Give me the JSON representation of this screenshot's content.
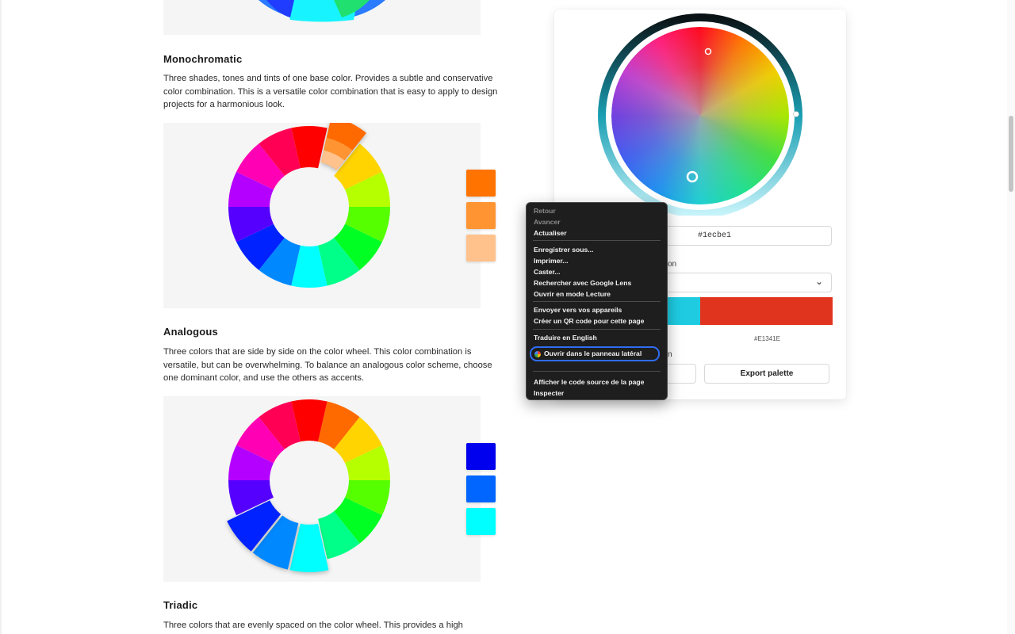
{
  "sections": [
    {
      "title": "Monochromatic",
      "description": "Three shades, tones and tints of one base color. Provides a subtle and conservative color combination. This is a versatile color combination that is easy to apply to design projects for a harmonious look.",
      "swatches": [
        "#ff7300",
        "#ff9433",
        "#ffc28d"
      ]
    },
    {
      "title": "Analogous",
      "description": "Three colors that are side by side on the color wheel. This color combination is versatile, but can be overwhelming. To balance an analogous color scheme, choose one dominant color, and use the others as accents.",
      "swatches": [
        "#0000ee",
        "#0066ff",
        "#00ffff"
      ]
    },
    {
      "title": "Triadic",
      "description": "Three colors that are evenly spaced on the color wheel. This provides a high"
    }
  ],
  "wheel_colors": [
    "#ff0000",
    "#ff6a00",
    "#ffd400",
    "#b6ff00",
    "#55ff00",
    "#00ff22",
    "#00ff88",
    "#00ffff",
    "#0088ff",
    "#0022ff",
    "#5500ff",
    "#b400ff",
    "#ff00b4",
    "#ff0055"
  ],
  "tool": {
    "hex_value": "#1ecbe1",
    "partial_label_1": "on",
    "partial_label_2": "n",
    "palette": [
      "#1ecbe1",
      "#e1341e"
    ],
    "hex_caption": "#E1341E",
    "export_button": "Export palette",
    "chevron_icon": "chevron-down-icon"
  },
  "context_menu": {
    "items": [
      {
        "label": "Retour",
        "disabled": true
      },
      {
        "label": "Avancer",
        "disabled": true
      },
      {
        "label": "Actualiser",
        "disabled": false
      },
      {
        "label": "Enregistrer sous...",
        "disabled": false
      },
      {
        "label": "Imprimer...",
        "disabled": false
      },
      {
        "label": "Caster...",
        "disabled": false
      },
      {
        "label": "Rechercher avec Google Lens",
        "disabled": false
      },
      {
        "label": "Ouvrir en mode Lecture",
        "disabled": false
      },
      {
        "label": "Envoyer vers vos appareils",
        "disabled": false
      },
      {
        "label": "Créer un QR code pour cette page",
        "disabled": false
      },
      {
        "label": "Traduire en English",
        "disabled": false
      },
      {
        "label": "Ouvrir dans le panneau latéral",
        "disabled": false
      },
      {
        "label": "Afficher le code source de la page",
        "disabled": false
      },
      {
        "label": "Inspecter",
        "disabled": false
      }
    ]
  }
}
